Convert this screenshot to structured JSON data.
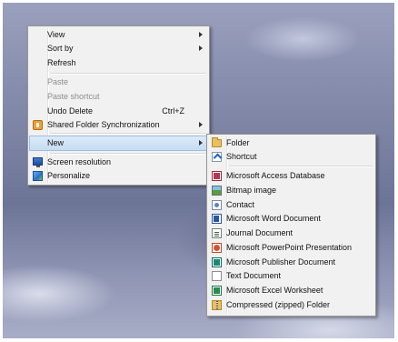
{
  "context_menu": {
    "items": [
      {
        "label": "View",
        "submenu": true
      },
      {
        "label": "Sort by",
        "submenu": true
      },
      {
        "label": "Refresh"
      },
      {
        "label": "Paste",
        "disabled": true
      },
      {
        "label": "Paste shortcut",
        "disabled": true
      },
      {
        "label": "Undo Delete",
        "accel": "Ctrl+Z"
      },
      {
        "label": "Shared Folder Synchronization",
        "submenu": true,
        "icon": "sync-icon"
      },
      {
        "label": "New",
        "submenu": true,
        "highlighted": true
      },
      {
        "label": "Screen resolution",
        "icon": "monitor-icon"
      },
      {
        "label": "Personalize",
        "icon": "personalize-icon"
      }
    ]
  },
  "new_submenu": {
    "items": [
      {
        "label": "Folder",
        "icon": "folder-icon"
      },
      {
        "label": "Shortcut",
        "icon": "shortcut-icon"
      },
      {
        "label": "Microsoft Access Database",
        "icon": "access-icon"
      },
      {
        "label": "Bitmap image",
        "icon": "bitmap-icon"
      },
      {
        "label": "Contact",
        "icon": "contact-icon"
      },
      {
        "label": "Microsoft Word Document",
        "icon": "word-icon"
      },
      {
        "label": "Journal Document",
        "icon": "journal-icon"
      },
      {
        "label": "Microsoft PowerPoint Presentation",
        "icon": "powerpoint-icon"
      },
      {
        "label": "Microsoft Publisher Document",
        "icon": "publisher-icon"
      },
      {
        "label": "Text Document",
        "icon": "text-document-icon"
      },
      {
        "label": "Microsoft Excel Worksheet",
        "icon": "excel-icon"
      },
      {
        "label": "Compressed (zipped) Folder",
        "icon": "zip-folder-icon"
      }
    ]
  },
  "colors": {
    "menu_background": "#f1f1f1",
    "highlight": "#c6dcf3",
    "disabled_text": "#8d8d8d"
  }
}
